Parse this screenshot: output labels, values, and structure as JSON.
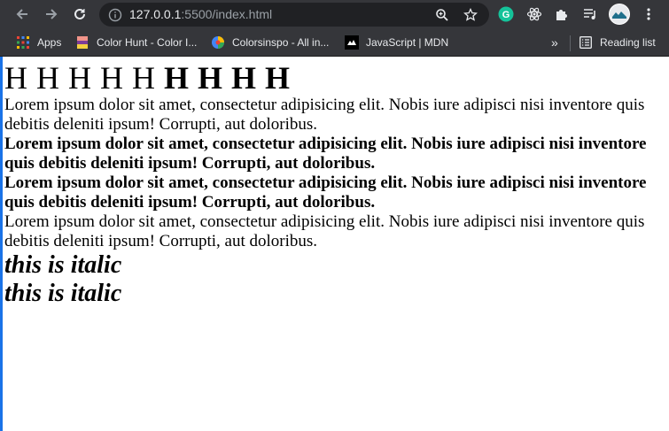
{
  "browser": {
    "url_host": "127.0.0.1",
    "url_rest": ":5500/index.html",
    "bookmarks": [
      {
        "label": "Apps",
        "icon": "apps-grid-icon"
      },
      {
        "label": "Color Hunt - Color I...",
        "icon": "color-hunt-icon"
      },
      {
        "label": "Colorsinspo - All in...",
        "icon": "colorsinspo-icon"
      },
      {
        "label": "JavaScript | MDN",
        "icon": "mdn-icon"
      }
    ],
    "overflow_label": "»",
    "reading_list_label": "Reading list"
  },
  "page": {
    "letters_normal": [
      "H",
      "H",
      "H",
      "H",
      "H"
    ],
    "letters_bold": [
      "H",
      "H",
      "H",
      "H"
    ],
    "paragraphs": [
      {
        "text": "Lorem ipsum dolor sit amet, consectetur adipisicing elit. Nobis iure adipisci nisi inventore quis debitis deleniti ipsum! Corrupti, aut doloribus.",
        "bold": false
      },
      {
        "text": "Lorem ipsum dolor sit amet, consectetur adipisicing elit. Nobis iure adipisci nisi inventore quis debitis deleniti ipsum! Corrupti, aut doloribus.",
        "bold": true
      },
      {
        "text": "Lorem ipsum dolor sit amet, consectetur adipisicing elit. Nobis iure adipisci nisi inventore quis debitis deleniti ipsum! Corrupti, aut doloribus.",
        "bold": true
      },
      {
        "text": "Lorem ipsum dolor sit amet, consectetur adipisicing elit. Nobis iure adipisci nisi inventore quis debitis deleniti ipsum! Corrupti, aut doloribus.",
        "bold": false
      }
    ],
    "italics": [
      "this is italic",
      "this is italic"
    ]
  }
}
